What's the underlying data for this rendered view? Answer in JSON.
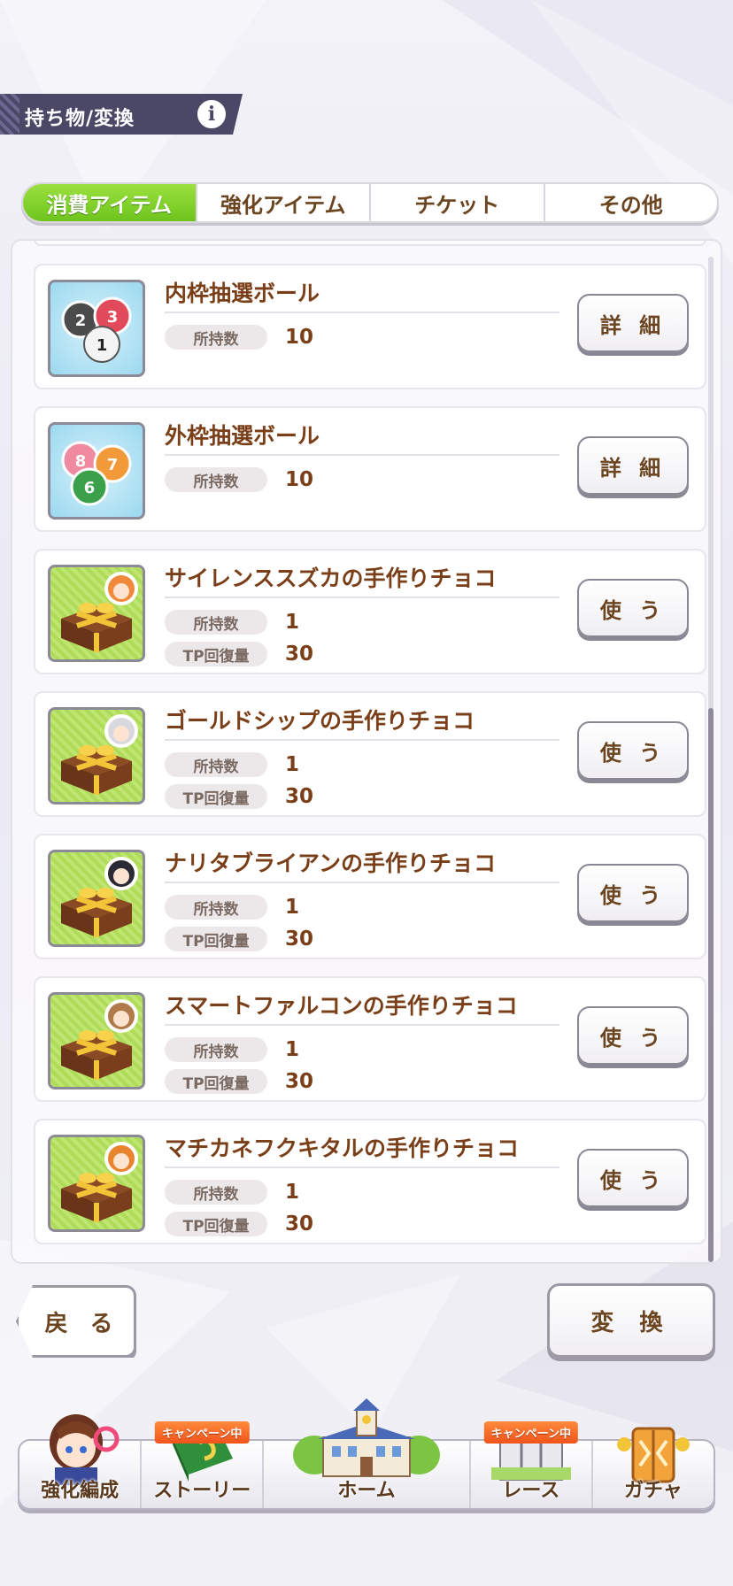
{
  "header": {
    "title": "持ち物/変換",
    "info_icon": "info-icon"
  },
  "tabs": [
    {
      "label": "消費アイテム",
      "active": true
    },
    {
      "label": "強化アイテム",
      "active": false
    },
    {
      "label": "チケット",
      "active": false
    },
    {
      "label": "その他",
      "active": false
    }
  ],
  "items": [
    {
      "name": "内枠抽選ボール",
      "icon": "inner-lottery-balls-icon",
      "owned_label": "所持数",
      "owned": "10",
      "button": "詳 細"
    },
    {
      "name": "外枠抽選ボール",
      "icon": "outer-lottery-balls-icon",
      "owned_label": "所持数",
      "owned": "10",
      "button": "詳 細"
    },
    {
      "name": "サイレンススズカの手作りチョコ",
      "icon": "handmade-choco-icon",
      "owned_label": "所持数",
      "owned": "1",
      "tp_label": "TP回復量",
      "tp": "30",
      "button": "使 う"
    },
    {
      "name": "ゴールドシップの手作りチョコ",
      "icon": "handmade-choco-icon",
      "owned_label": "所持数",
      "owned": "1",
      "tp_label": "TP回復量",
      "tp": "30",
      "button": "使 う"
    },
    {
      "name": "ナリタブライアンの手作りチョコ",
      "icon": "handmade-choco-icon",
      "owned_label": "所持数",
      "owned": "1",
      "tp_label": "TP回復量",
      "tp": "30",
      "button": "使 う"
    },
    {
      "name": "スマートファルコンの手作りチョコ",
      "icon": "handmade-choco-icon",
      "owned_label": "所持数",
      "owned": "1",
      "tp_label": "TP回復量",
      "tp": "30",
      "button": "使 う"
    },
    {
      "name": "マチカネフクキタルの手作りチョコ",
      "icon": "handmade-choco-icon",
      "owned_label": "所持数",
      "owned": "1",
      "tp_label": "TP回復量",
      "tp": "30",
      "button": "使 う"
    }
  ],
  "inner_balls": [
    "2",
    "3",
    "1"
  ],
  "outer_balls": [
    "8",
    "7",
    "6"
  ],
  "footer": {
    "back_label": "戻 る",
    "convert_label": "変 換"
  },
  "nav": [
    {
      "label": "強化編成",
      "icon": "character-icon",
      "campaign": ""
    },
    {
      "label": "ストーリー",
      "icon": "story-book-icon",
      "campaign": "キャンペーン中"
    },
    {
      "label": "ホーム",
      "icon": "home-building-icon",
      "campaign": ""
    },
    {
      "label": "レース",
      "icon": "race-gate-icon",
      "campaign": "キャンペーン中"
    },
    {
      "label": "ガチャ",
      "icon": "gacha-door-icon",
      "campaign": ""
    }
  ],
  "colors": {
    "active_tab": "#7ccf28",
    "header_bg": "#4a4866",
    "text_brown": "#7a3f18",
    "campaign_orange": "#f0531b"
  }
}
